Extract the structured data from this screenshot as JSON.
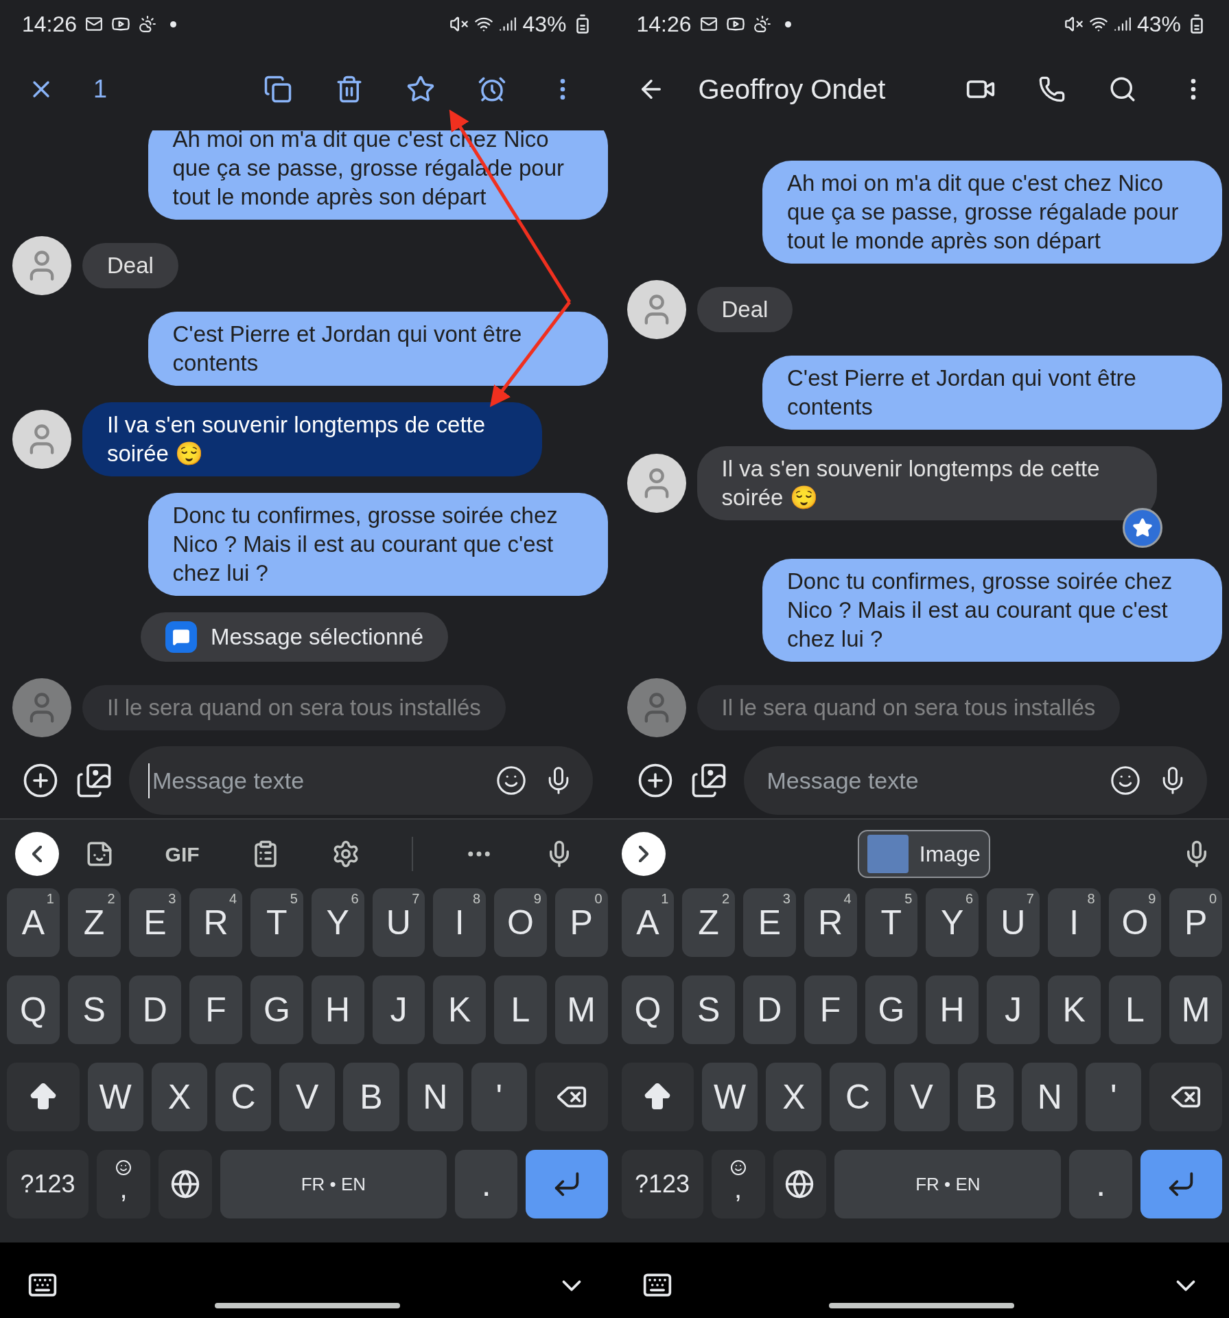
{
  "screens": [
    {
      "status_bar": {
        "time": "14:26",
        "battery": "43%"
      },
      "header": {
        "kind": "selection",
        "count": "1"
      },
      "messages": [
        {
          "kind": "sent",
          "text": "Ah moi on m'a dit que c'est chez Nico que ça se passe, grosse régalade pour tout le monde après son départ",
          "selected": false
        },
        {
          "kind": "received",
          "text": "Deal",
          "selected": false
        },
        {
          "kind": "sent",
          "text": "C'est Pierre et Jordan qui vont être contents",
          "selected": false
        },
        {
          "kind": "received",
          "text": "Il va s'en souvenir longtemps de cette soirée 😌",
          "selected": true,
          "starred": false
        },
        {
          "kind": "sent",
          "text": "Donc tu confirmes, grosse soirée chez Nico ? Mais il est au courant que c'est chez lui ?",
          "selected": false
        },
        {
          "kind": "received",
          "text": "Il le sera quand on sera tous installés",
          "selected": false
        }
      ],
      "toast": "Message sélectionné",
      "composer": {
        "placeholder": "Message texte",
        "focused": true
      },
      "keyboard": {
        "toolbar": {
          "kind": "tools",
          "label": "GIF"
        },
        "rows": [
          {
            "keys": [
              {
                "kind": "char",
                "label": "A",
                "hint": "1"
              },
              {
                "kind": "char",
                "label": "Z",
                "hint": "2"
              },
              {
                "kind": "char",
                "label": "E",
                "hint": "3"
              },
              {
                "kind": "char",
                "label": "R",
                "hint": "4"
              },
              {
                "kind": "char",
                "label": "T",
                "hint": "5"
              },
              {
                "kind": "char",
                "label": "Y",
                "hint": "6"
              },
              {
                "kind": "char",
                "label": "U",
                "hint": "7"
              },
              {
                "kind": "char",
                "label": "I",
                "hint": "8"
              },
              {
                "kind": "char",
                "label": "O",
                "hint": "9"
              },
              {
                "kind": "char",
                "label": "P",
                "hint": "0"
              }
            ]
          },
          {
            "keys": [
              {
                "kind": "char",
                "label": "Q"
              },
              {
                "kind": "char",
                "label": "S"
              },
              {
                "kind": "char",
                "label": "D"
              },
              {
                "kind": "char",
                "label": "F"
              },
              {
                "kind": "char",
                "label": "G"
              },
              {
                "kind": "char",
                "label": "H"
              },
              {
                "kind": "char",
                "label": "J"
              },
              {
                "kind": "char",
                "label": "K"
              },
              {
                "kind": "char",
                "label": "L"
              },
              {
                "kind": "char",
                "label": "M"
              }
            ]
          },
          {
            "keys": [
              {
                "kind": "shift"
              },
              {
                "kind": "char",
                "label": "W"
              },
              {
                "kind": "char",
                "label": "X"
              },
              {
                "kind": "char",
                "label": "C"
              },
              {
                "kind": "char",
                "label": "V"
              },
              {
                "kind": "char",
                "label": "B"
              },
              {
                "kind": "char",
                "label": "N"
              },
              {
                "kind": "char",
                "label": "'"
              },
              {
                "kind": "backspace"
              }
            ]
          },
          {
            "keys": [
              {
                "kind": "symbols",
                "label": "?123"
              },
              {
                "kind": "emoji-comma",
                "label": ","
              },
              {
                "kind": "globe"
              },
              {
                "kind": "space",
                "label": "FR • EN"
              },
              {
                "kind": "char",
                "label": "."
              },
              {
                "kind": "enter"
              }
            ]
          }
        ]
      }
    },
    {
      "status_bar": {
        "time": "14:26",
        "battery": "43%"
      },
      "header": {
        "kind": "conversation",
        "title": "Geoffroy Ondet"
      },
      "messages": [
        {
          "kind": "sent",
          "text": "Ah moi on m'a dit que c'est chez Nico que ça se passe, grosse régalade pour tout le monde après son départ",
          "selected": false
        },
        {
          "kind": "received",
          "text": "Deal",
          "selected": false
        },
        {
          "kind": "sent",
          "text": "C'est Pierre et Jordan qui vont être contents",
          "selected": false
        },
        {
          "kind": "received",
          "text": "Il va s'en souvenir longtemps de cette soirée 😌",
          "selected": false,
          "starred": true
        },
        {
          "kind": "sent",
          "text": "Donc tu confirmes, grosse soirée chez Nico ? Mais il est au courant que c'est chez lui ?",
          "selected": false
        },
        {
          "kind": "received",
          "text": "Il le sera quand on sera tous installés",
          "selected": false
        }
      ],
      "composer": {
        "placeholder": "Message texte",
        "focused": false
      },
      "keyboard": {
        "toolbar": {
          "kind": "suggestion",
          "label": "Image"
        },
        "rows": [
          {
            "keys": [
              {
                "kind": "char",
                "label": "A",
                "hint": "1"
              },
              {
                "kind": "char",
                "label": "Z",
                "hint": "2"
              },
              {
                "kind": "char",
                "label": "E",
                "hint": "3"
              },
              {
                "kind": "char",
                "label": "R",
                "hint": "4"
              },
              {
                "kind": "char",
                "label": "T",
                "hint": "5"
              },
              {
                "kind": "char",
                "label": "Y",
                "hint": "6"
              },
              {
                "kind": "char",
                "label": "U",
                "hint": "7"
              },
              {
                "kind": "char",
                "label": "I",
                "hint": "8"
              },
              {
                "kind": "char",
                "label": "O",
                "hint": "9"
              },
              {
                "kind": "char",
                "label": "P",
                "hint": "0"
              }
            ]
          },
          {
            "keys": [
              {
                "kind": "char",
                "label": "Q"
              },
              {
                "kind": "char",
                "label": "S"
              },
              {
                "kind": "char",
                "label": "D"
              },
              {
                "kind": "char",
                "label": "F"
              },
              {
                "kind": "char",
                "label": "G"
              },
              {
                "kind": "char",
                "label": "H"
              },
              {
                "kind": "char",
                "label": "J"
              },
              {
                "kind": "char",
                "label": "K"
              },
              {
                "kind": "char",
                "label": "L"
              },
              {
                "kind": "char",
                "label": "M"
              }
            ]
          },
          {
            "keys": [
              {
                "kind": "shift"
              },
              {
                "kind": "char",
                "label": "W"
              },
              {
                "kind": "char",
                "label": "X"
              },
              {
                "kind": "char",
                "label": "C"
              },
              {
                "kind": "char",
                "label": "V"
              },
              {
                "kind": "char",
                "label": "B"
              },
              {
                "kind": "char",
                "label": "N"
              },
              {
                "kind": "char",
                "label": "'"
              },
              {
                "kind": "backspace"
              }
            ]
          },
          {
            "keys": [
              {
                "kind": "symbols",
                "label": "?123"
              },
              {
                "kind": "emoji-comma",
                "label": ","
              },
              {
                "kind": "globe"
              },
              {
                "kind": "space",
                "label": "FR • EN"
              },
              {
                "kind": "char",
                "label": "."
              },
              {
                "kind": "enter"
              }
            ]
          }
        ]
      }
    }
  ]
}
